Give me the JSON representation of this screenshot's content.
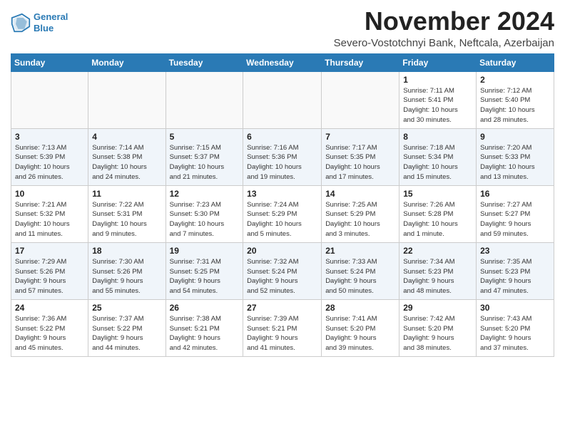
{
  "header": {
    "logo_line1": "General",
    "logo_line2": "Blue",
    "month": "November 2024",
    "location": "Severo-Vostotchnyi Bank, Neftcala, Azerbaijan"
  },
  "weekdays": [
    "Sunday",
    "Monday",
    "Tuesday",
    "Wednesday",
    "Thursday",
    "Friday",
    "Saturday"
  ],
  "weeks": [
    [
      {
        "day": "",
        "info": ""
      },
      {
        "day": "",
        "info": ""
      },
      {
        "day": "",
        "info": ""
      },
      {
        "day": "",
        "info": ""
      },
      {
        "day": "",
        "info": ""
      },
      {
        "day": "1",
        "info": "Sunrise: 7:11 AM\nSunset: 5:41 PM\nDaylight: 10 hours\nand 30 minutes."
      },
      {
        "day": "2",
        "info": "Sunrise: 7:12 AM\nSunset: 5:40 PM\nDaylight: 10 hours\nand 28 minutes."
      }
    ],
    [
      {
        "day": "3",
        "info": "Sunrise: 7:13 AM\nSunset: 5:39 PM\nDaylight: 10 hours\nand 26 minutes."
      },
      {
        "day": "4",
        "info": "Sunrise: 7:14 AM\nSunset: 5:38 PM\nDaylight: 10 hours\nand 24 minutes."
      },
      {
        "day": "5",
        "info": "Sunrise: 7:15 AM\nSunset: 5:37 PM\nDaylight: 10 hours\nand 21 minutes."
      },
      {
        "day": "6",
        "info": "Sunrise: 7:16 AM\nSunset: 5:36 PM\nDaylight: 10 hours\nand 19 minutes."
      },
      {
        "day": "7",
        "info": "Sunrise: 7:17 AM\nSunset: 5:35 PM\nDaylight: 10 hours\nand 17 minutes."
      },
      {
        "day": "8",
        "info": "Sunrise: 7:18 AM\nSunset: 5:34 PM\nDaylight: 10 hours\nand 15 minutes."
      },
      {
        "day": "9",
        "info": "Sunrise: 7:20 AM\nSunset: 5:33 PM\nDaylight: 10 hours\nand 13 minutes."
      }
    ],
    [
      {
        "day": "10",
        "info": "Sunrise: 7:21 AM\nSunset: 5:32 PM\nDaylight: 10 hours\nand 11 minutes."
      },
      {
        "day": "11",
        "info": "Sunrise: 7:22 AM\nSunset: 5:31 PM\nDaylight: 10 hours\nand 9 minutes."
      },
      {
        "day": "12",
        "info": "Sunrise: 7:23 AM\nSunset: 5:30 PM\nDaylight: 10 hours\nand 7 minutes."
      },
      {
        "day": "13",
        "info": "Sunrise: 7:24 AM\nSunset: 5:29 PM\nDaylight: 10 hours\nand 5 minutes."
      },
      {
        "day": "14",
        "info": "Sunrise: 7:25 AM\nSunset: 5:29 PM\nDaylight: 10 hours\nand 3 minutes."
      },
      {
        "day": "15",
        "info": "Sunrise: 7:26 AM\nSunset: 5:28 PM\nDaylight: 10 hours\nand 1 minute."
      },
      {
        "day": "16",
        "info": "Sunrise: 7:27 AM\nSunset: 5:27 PM\nDaylight: 9 hours\nand 59 minutes."
      }
    ],
    [
      {
        "day": "17",
        "info": "Sunrise: 7:29 AM\nSunset: 5:26 PM\nDaylight: 9 hours\nand 57 minutes."
      },
      {
        "day": "18",
        "info": "Sunrise: 7:30 AM\nSunset: 5:26 PM\nDaylight: 9 hours\nand 55 minutes."
      },
      {
        "day": "19",
        "info": "Sunrise: 7:31 AM\nSunset: 5:25 PM\nDaylight: 9 hours\nand 54 minutes."
      },
      {
        "day": "20",
        "info": "Sunrise: 7:32 AM\nSunset: 5:24 PM\nDaylight: 9 hours\nand 52 minutes."
      },
      {
        "day": "21",
        "info": "Sunrise: 7:33 AM\nSunset: 5:24 PM\nDaylight: 9 hours\nand 50 minutes."
      },
      {
        "day": "22",
        "info": "Sunrise: 7:34 AM\nSunset: 5:23 PM\nDaylight: 9 hours\nand 48 minutes."
      },
      {
        "day": "23",
        "info": "Sunrise: 7:35 AM\nSunset: 5:23 PM\nDaylight: 9 hours\nand 47 minutes."
      }
    ],
    [
      {
        "day": "24",
        "info": "Sunrise: 7:36 AM\nSunset: 5:22 PM\nDaylight: 9 hours\nand 45 minutes."
      },
      {
        "day": "25",
        "info": "Sunrise: 7:37 AM\nSunset: 5:22 PM\nDaylight: 9 hours\nand 44 minutes."
      },
      {
        "day": "26",
        "info": "Sunrise: 7:38 AM\nSunset: 5:21 PM\nDaylight: 9 hours\nand 42 minutes."
      },
      {
        "day": "27",
        "info": "Sunrise: 7:39 AM\nSunset: 5:21 PM\nDaylight: 9 hours\nand 41 minutes."
      },
      {
        "day": "28",
        "info": "Sunrise: 7:41 AM\nSunset: 5:20 PM\nDaylight: 9 hours\nand 39 minutes."
      },
      {
        "day": "29",
        "info": "Sunrise: 7:42 AM\nSunset: 5:20 PM\nDaylight: 9 hours\nand 38 minutes."
      },
      {
        "day": "30",
        "info": "Sunrise: 7:43 AM\nSunset: 5:20 PM\nDaylight: 9 hours\nand 37 minutes."
      }
    ]
  ]
}
